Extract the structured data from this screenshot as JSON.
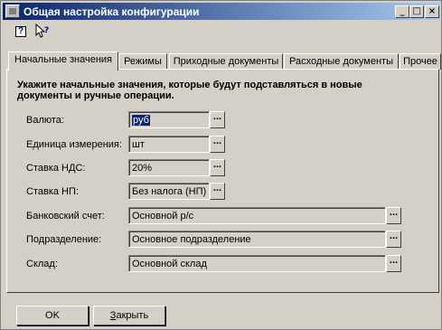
{
  "window": {
    "title": "Общая настройка конфигурации"
  },
  "titlebar": {
    "minimize": "_",
    "maximize": "□",
    "close": "×"
  },
  "toolbar": {
    "help_glyph": "?",
    "whatsthis_glyph": "↖?"
  },
  "tabs": [
    {
      "label": "Начальные значения",
      "active": true
    },
    {
      "label": "Режимы",
      "active": false
    },
    {
      "label": "Приходные документы",
      "active": false
    },
    {
      "label": "Расходные документы",
      "active": false
    },
    {
      "label": "Прочее",
      "active": false
    }
  ],
  "instruction": "Укажите начальные значения, которые будут подставляться в новые документы и ручные операции.",
  "fields": [
    {
      "label": "Валюта:",
      "value": "руб"
    },
    {
      "label": "Единица измерения:",
      "value": "шт"
    },
    {
      "label": "Ставка НДС:",
      "value": "20%"
    },
    {
      "label": "Ставка НП:",
      "value": "Без налога (НП)"
    },
    {
      "label": "Банковский счет:",
      "value": "Основной р/с"
    },
    {
      "label": "Подразделение:",
      "value": "Основное подразделение"
    },
    {
      "label": "Склад:",
      "value": "Основной склад"
    }
  ],
  "pick_label": "...",
  "buttons": {
    "ok": "OK",
    "close_underlined": "З",
    "close_rest": "акрыть"
  }
}
